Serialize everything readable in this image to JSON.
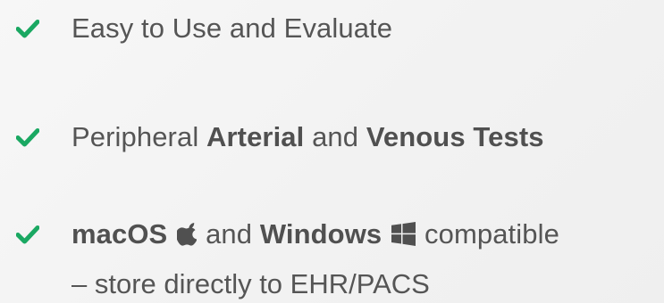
{
  "features": [
    {
      "text": "Easy to Use and Evaluate",
      "icon": "check-icon"
    },
    {
      "part1": "Peripheral ",
      "part2": "Arterial",
      "part3": " and ",
      "part4": "Venous Tests",
      "icon": "check-icon"
    },
    {
      "part1": "macOS",
      "part2": "and",
      "part3": "Windows",
      "part4": "compatible",
      "line2": "– store directly to EHR/PACS",
      "icon": "check-icon",
      "os_icons": [
        "apple-icon",
        "windows-icon"
      ]
    }
  ],
  "colors": {
    "check": "#1aa862",
    "text": "#555555",
    "background": "#f4f4f4"
  }
}
